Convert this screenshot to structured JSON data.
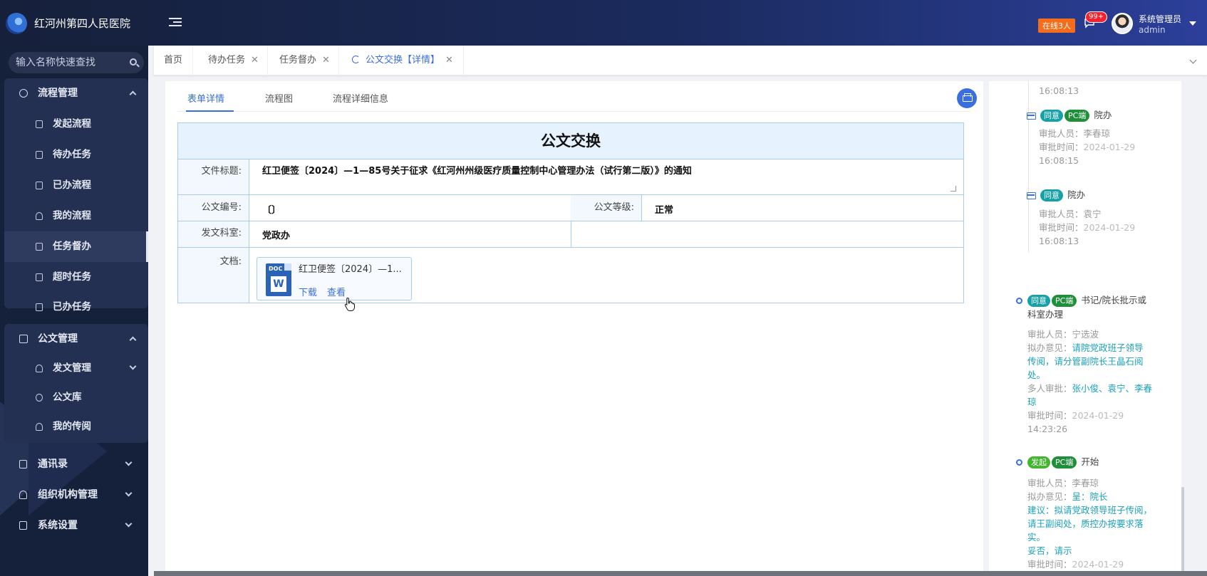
{
  "header": {
    "app_title": "红河州第四人民医院",
    "online_badge": "在线3人",
    "message_count": "99+",
    "user_name": "系统管理员",
    "user_role": "admin"
  },
  "sidebar": {
    "search_placeholder": "输入名称快速查找",
    "groups": [
      {
        "label": "流程管理",
        "items": [
          "发起流程",
          "待办任务",
          "已办流程",
          "我的流程",
          "任务督办",
          "超时任务",
          "已办任务"
        ]
      },
      {
        "label": "公文管理",
        "items": [
          "发文管理",
          "公文库",
          "我的传阅"
        ]
      }
    ],
    "top_items": [
      "通讯录",
      "组织机构管理",
      "系统设置"
    ],
    "active_item": "任务督办"
  },
  "tabs": [
    "首页",
    "待办任务",
    "任务督办",
    "公文交换【详情】"
  ],
  "active_tab": "公文交换【详情】",
  "subtabs": [
    "表单详情",
    "流程图",
    "流程详细信息"
  ],
  "form": {
    "title": "公文交换",
    "labels": {
      "doc_title": "文件标题:",
      "doc_no": "公文编号:",
      "doc_level": "公文等级:",
      "dept": "发文科室:",
      "attachment": "文档:"
    },
    "values": {
      "doc_title": "红卫便签〔2024〕—1—85号关于征求《红河州州级医疗质量控制中心管理办法（试行第二版）》的通知",
      "doc_no": "〔〕",
      "doc_level": "正常",
      "dept": "党政办"
    },
    "attachment": {
      "name": "红卫便签〔2024〕—1...",
      "download": "下载",
      "view": "查看",
      "file_type": "DOC"
    }
  },
  "timeline": {
    "top_time": "16:08:13",
    "entries": [
      {
        "tags": [
          "同意",
          "PC端"
        ],
        "node": "院办",
        "approver": "审批人员：李春琼",
        "time_label": "审批时间：",
        "date": "2024-01-29",
        "time": "16:08:15"
      },
      {
        "tags": [
          "同意"
        ],
        "node": "院办",
        "approver": "审批人员：袁宁",
        "time_label": "审批时间：",
        "date": "2024-01-29",
        "time": "16:08:13"
      },
      {
        "tags": [
          "同意",
          "PC端"
        ],
        "node_l1": "书记/院长批示或",
        "node_l2": "科室办理",
        "approver": "审批人员：宁选波",
        "opinion_label": "拟办意见：",
        "opinion_l1": "请院党政班子领导",
        "opinion_l2": "传阅，请分管副院长王晶石阅",
        "opinion_l3": "处。",
        "multi_label": "多人审批：",
        "multi_l1": "张小俊、袁宁、李春",
        "multi_l2": "琼",
        "time_label": "审批时间：",
        "date": "2024-01-29",
        "time": "14:23:26"
      },
      {
        "tags": [
          "发起",
          "PC端"
        ],
        "node": "开始",
        "approver": "审批人员：李春琼",
        "opinion_label": "拟办意见：",
        "opinion_l1": "呈：院长",
        "suggest_l1": "建议：拟请党政领导班子传阅，",
        "suggest_l2": "请王副阅处，质控办按要求落",
        "suggest_l3": "实。",
        "suggest_l4": "妥否，请示",
        "time_label": "审批时间：",
        "date": "2024-01-29"
      }
    ]
  },
  "colors": {
    "accent": "#3a6fe0",
    "sidebar_bg": "#15203b",
    "tag_agree": "#16a0a8",
    "tag_pc": "#1f8f3a",
    "tag_start": "#43b62f",
    "badge_orange": "#f56c1a"
  }
}
